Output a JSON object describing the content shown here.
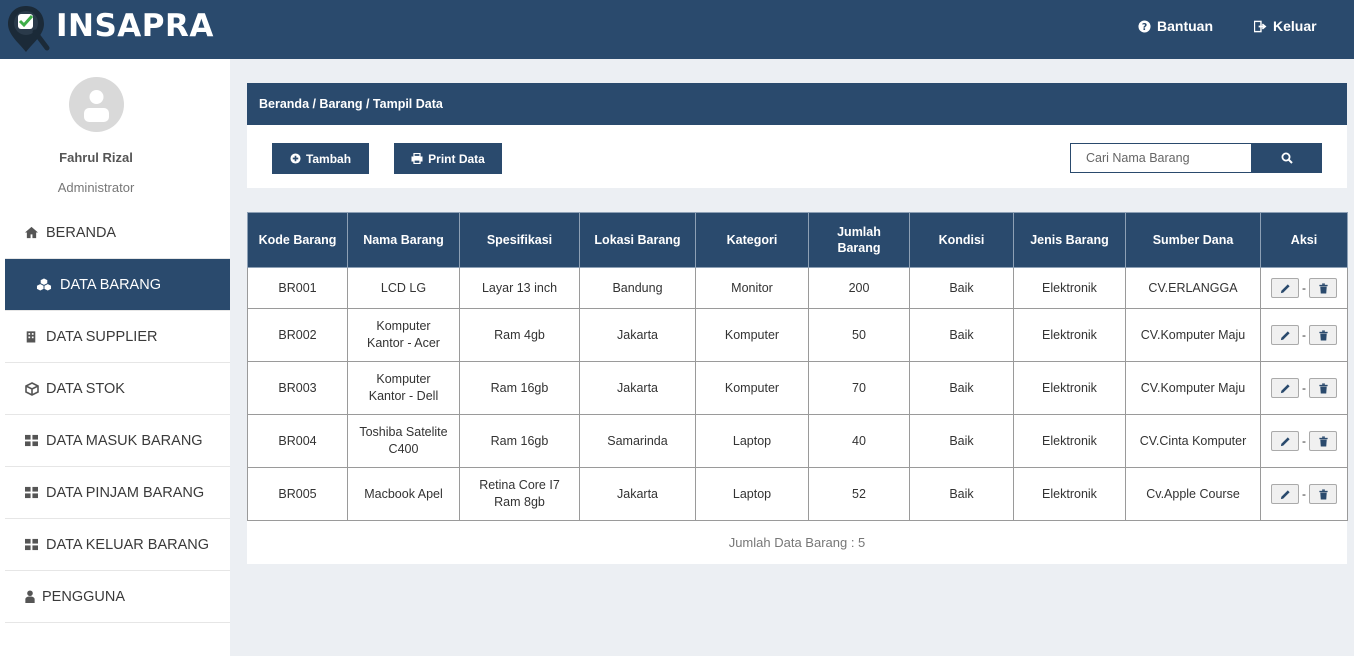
{
  "app": {
    "brand": "INSAPRA"
  },
  "topbar": {
    "help_label": "Bantuan",
    "logout_label": "Keluar"
  },
  "user": {
    "name": "Fahrul Rizal",
    "role": "Administrator"
  },
  "menu": [
    {
      "label": "BERANDA",
      "icon": "home-icon"
    },
    {
      "label": "DATA BARANG",
      "icon": "cubes-icon",
      "active": true
    },
    {
      "label": "DATA SUPPLIER",
      "icon": "building-icon"
    },
    {
      "label": "DATA STOK",
      "icon": "cube-icon"
    },
    {
      "label": "DATA MASUK BARANG",
      "icon": "grid-icon"
    },
    {
      "label": "DATA PINJAM BARANG",
      "icon": "grid-icon"
    },
    {
      "label": "DATA KELUAR BARANG",
      "icon": "grid-icon"
    },
    {
      "label": "PENGGUNA",
      "icon": "user-icon"
    }
  ],
  "breadcrumb": "Beranda / Barang / Tampil Data",
  "toolbar": {
    "add_label": "Tambah",
    "print_label": "Print Data",
    "search_placeholder": "Cari Nama Barang"
  },
  "table": {
    "headers": [
      "Kode Barang",
      "Nama Barang",
      "Spesifikasi",
      "Lokasi Barang",
      "Kategori",
      "Jumlah Barang",
      "Kondisi",
      "Jenis Barang",
      "Sumber Dana",
      "Aksi"
    ],
    "rows": [
      [
        "BR001",
        "LCD LG",
        "Layar 13 inch",
        "Bandung",
        "Monitor",
        "200",
        "Baik",
        "Elektronik",
        "CV.ERLANGGA"
      ],
      [
        "BR002",
        "Komputer Kantor - Acer",
        "Ram 4gb",
        "Jakarta",
        "Komputer",
        "50",
        "Baik",
        "Elektronik",
        "CV.Komputer Maju"
      ],
      [
        "BR003",
        "Komputer Kantor - Dell",
        "Ram 16gb",
        "Jakarta",
        "Komputer",
        "70",
        "Baik",
        "Elektronik",
        "CV.Komputer Maju"
      ],
      [
        "BR004",
        "Toshiba Satelite C400",
        "Ram 16gb",
        "Samarinda",
        "Laptop",
        "40",
        "Baik",
        "Elektronik",
        "CV.Cinta Komputer"
      ],
      [
        "BR005",
        "Macbook Apel",
        "Retina Core I7 Ram 8gb",
        "Jakarta",
        "Laptop",
        "52",
        "Baik",
        "Elektronik",
        "Cv.Apple Course"
      ]
    ],
    "aksi_separator": "-"
  },
  "footer": {
    "count_text": "Jumlah Data Barang : 5"
  },
  "colors": {
    "primary": "#2a4a6d",
    "background": "#eceff3"
  }
}
